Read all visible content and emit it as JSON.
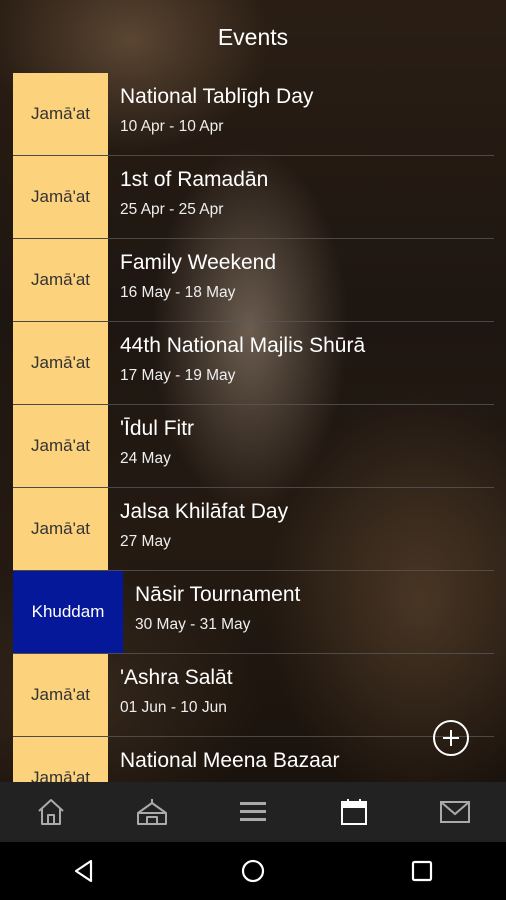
{
  "header": {
    "title": "Events"
  },
  "events": [
    {
      "category": "Jamā'at",
      "name": "National Tablīgh Day",
      "date": "10 Apr - 10 Apr"
    },
    {
      "category": "Jamā'at",
      "name": "1st of Ramadān",
      "date": "25 Apr - 25 Apr"
    },
    {
      "category": "Jamā'at",
      "name": "Family Weekend",
      "date": "16 May - 18 May"
    },
    {
      "category": "Jamā'at",
      "name": "44th National Majlis Shūrā",
      "date": "17 May - 19 May"
    },
    {
      "category": "Jamā'at",
      "name": "'Īdul Fitr",
      "date": "24 May"
    },
    {
      "category": "Jamā'at",
      "name": "Jalsa Khilāfat Day",
      "date": "27 May"
    },
    {
      "category": "Khuddam",
      "name": "Nāsir Tournament",
      "date": "30 May - 31 May"
    },
    {
      "category": "Jamā'at",
      "name": "'Ashra Salāt",
      "date": "01 Jun - 10 Jun"
    },
    {
      "category": "Jamā'at",
      "name": "National Meena Bazaar",
      "date": ""
    }
  ],
  "colors": {
    "jamaat_tag": "#fdd27d",
    "khuddam_tag": "#06189a",
    "tabbar": "#222222"
  },
  "tabbar": {
    "items": [
      {
        "icon": "home-icon",
        "active": false
      },
      {
        "icon": "mosque-icon",
        "active": false
      },
      {
        "icon": "menu-icon",
        "active": false
      },
      {
        "icon": "calendar-icon",
        "active": true
      },
      {
        "icon": "mail-icon",
        "active": false
      }
    ]
  },
  "system_nav": {
    "items": [
      "back-icon",
      "home-circle-icon",
      "recents-icon"
    ]
  }
}
